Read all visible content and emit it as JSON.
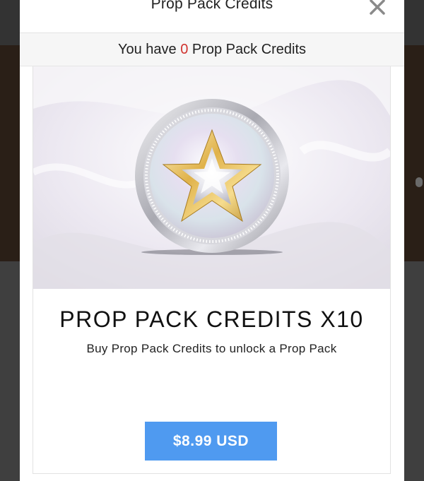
{
  "modal": {
    "title": "Prop Pack Credits",
    "close_icon": "close-icon"
  },
  "credits_bar": {
    "prefix": "You have",
    "count": "0",
    "suffix": "Prop Pack Credits",
    "count_color": "#d0322e"
  },
  "product": {
    "image_icon": "star-coin-icon",
    "title": "PROP PACK CREDITS X10",
    "description": "Buy Prop Pack Credits to unlock a Prop Pack",
    "price_label": "$8.99 USD",
    "button_color": "#4f9af0"
  }
}
